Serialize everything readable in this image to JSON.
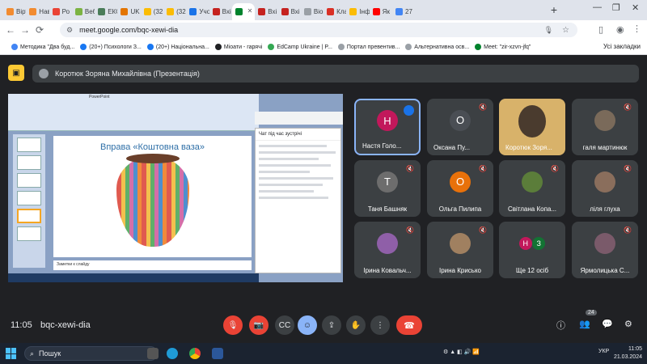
{
  "tabs": [
    {
      "label": "Вірт",
      "color": "#f28b30"
    },
    {
      "label": "Нав",
      "color": "#f28b30"
    },
    {
      "label": "Ро",
      "color": "#ea4335"
    },
    {
      "label": "Веб",
      "color": "#7cb342"
    },
    {
      "label": "ЕКО",
      "color": "#4a7c59"
    },
    {
      "label": "UK",
      "color": "#e37400"
    },
    {
      "label": "(32",
      "color": "#fbbc04"
    },
    {
      "label": "(32",
      "color": "#fbbc04"
    },
    {
      "label": "Учо",
      "color": "#1a73e8"
    },
    {
      "label": "Вхі",
      "color": "#c5221f"
    },
    {
      "label": "",
      "color": "#00832d",
      "active": true
    },
    {
      "label": "Вхі",
      "color": "#c5221f"
    },
    {
      "label": "Вхі",
      "color": "#c5221f"
    },
    {
      "label": "Віо",
      "color": "#9aa0a6"
    },
    {
      "label": "Кла",
      "color": "#d93025"
    },
    {
      "label": "Інф",
      "color": "#fbbc04"
    },
    {
      "label": "Як",
      "color": "#ff0000"
    },
    {
      "label": "27",
      "color": "#4285f4"
    }
  ],
  "url": "meet.google.com/bqc-xewi-dia",
  "bookmarks": [
    {
      "label": "Методика \"Два буд...",
      "color": "#4285f4"
    },
    {
      "label": "(20+) Психологи З...",
      "color": "#1877f2"
    },
    {
      "label": "(20+) Національна...",
      "color": "#1877f2"
    },
    {
      "label": "Міоати - гарячі",
      "color": "#202124"
    },
    {
      "label": "EdCamp Ukraine | P...",
      "color": "#34a853"
    },
    {
      "label": "Портал превентив...",
      "color": "#9aa0a6"
    },
    {
      "label": "Альтернативна осв...",
      "color": "#9aa0a6"
    },
    {
      "label": "Meet: \"zir-xzvn-jfq\"",
      "color": "#00832d"
    }
  ],
  "bookmarks_all": "Усі закладки",
  "presenter": "Коротюк Зоряна Михайлівна (Презентація)",
  "slide_title": "Вправа «Коштовна ваза»",
  "notes_label": "Заметки к слайду",
  "chat_header": "Чат під час зустрічі",
  "participants": [
    {
      "name": "Настя Голо...",
      "initial": "Н",
      "color": "#c2185b",
      "active": true
    },
    {
      "name": "Оксана Пу...",
      "initial": "О",
      "color": "#4a4e54"
    },
    {
      "name": "Коротюк Зоря...",
      "initial": "",
      "color": "#6b8f5e"
    },
    {
      "name": "галя мартинюк",
      "initial": "",
      "color": "#7a6a5a"
    },
    {
      "name": "Таня Башняк",
      "initial": "Т",
      "color": "#6d6d6d"
    },
    {
      "name": "Ольга Пилипа",
      "initial": "О",
      "color": "#e8710a"
    },
    {
      "name": "Світлана Копа...",
      "initial": "",
      "color": "#5b7d3a"
    },
    {
      "name": "ліля глуха",
      "initial": "",
      "color": "#8a6e5c"
    },
    {
      "name": "Ірина Ковальч...",
      "initial": "",
      "color": "#8f5fa8"
    },
    {
      "name": "Ірина Крисько",
      "initial": "",
      "color": "#a08060"
    },
    {
      "name": "Ще 12 осіб",
      "initial": "Н",
      "initial2": "З",
      "color": "#c2185b",
      "color2": "#137333"
    },
    {
      "name": "Ярмолицька С...",
      "initial": "",
      "color": "#7a5a6a"
    }
  ],
  "reactions": [
    "💖",
    "👍",
    "🎉",
    "👏",
    "😂",
    "😮",
    "😢",
    "🤔",
    "👎"
  ],
  "time": "11:05",
  "meeting_code": "bqc-xewi-dia",
  "people_count": "24",
  "taskbar_search": "Пошук",
  "lang": "УКР",
  "clock_time": "11:05",
  "clock_date": "21.03.2024"
}
